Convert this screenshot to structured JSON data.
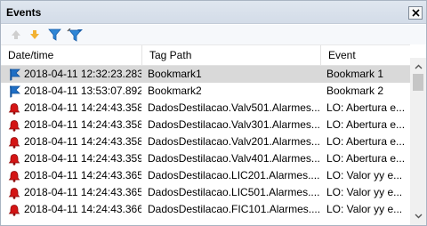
{
  "panel": {
    "title": "Events"
  },
  "toolbar": {
    "buttons": [
      {
        "name": "move-up",
        "color": "#c8c8c8"
      },
      {
        "name": "move-down",
        "color": "#f0b23c"
      },
      {
        "name": "filter",
        "color": "#2a7fd4"
      },
      {
        "name": "filter-edit",
        "color": "#2a7fd4"
      }
    ]
  },
  "table": {
    "columns": [
      "Date/time",
      "Tag Path",
      "Event"
    ],
    "rows": [
      {
        "icon": "bookmark-flag",
        "date": "2018-04-11 12:32:23.283",
        "tag": "Bookmark1",
        "event": "Bookmark 1",
        "selected": true
      },
      {
        "icon": "bookmark-flag",
        "date": "2018-04-11 13:53:07.892",
        "tag": "Bookmark2",
        "event": "Bookmark 2",
        "selected": false
      },
      {
        "icon": "alarm-bell",
        "date": "2018-04-11 14:24:43.358",
        "tag": "DadosDestilacao.Valv501.Alarmes....",
        "event": "LO: Abertura e...",
        "selected": false
      },
      {
        "icon": "alarm-bell",
        "date": "2018-04-11 14:24:43.358",
        "tag": "DadosDestilacao.Valv301.Alarmes....",
        "event": "LO: Abertura e...",
        "selected": false
      },
      {
        "icon": "alarm-bell",
        "date": "2018-04-11 14:24:43.358",
        "tag": "DadosDestilacao.Valv201.Alarmes....",
        "event": "LO: Abertura e...",
        "selected": false
      },
      {
        "icon": "alarm-bell",
        "date": "2018-04-11 14:24:43.359",
        "tag": "DadosDestilacao.Valv401.Alarmes....",
        "event": "LO: Abertura e...",
        "selected": false
      },
      {
        "icon": "alarm-bell",
        "date": "2018-04-11 14:24:43.365",
        "tag": "DadosDestilacao.LIC201.Alarmes....",
        "event": "LO: Valor yy e...",
        "selected": false
      },
      {
        "icon": "alarm-bell",
        "date": "2018-04-11 14:24:43.365",
        "tag": "DadosDestilacao.LIC501.Alarmes....",
        "event": "LO: Valor yy e...",
        "selected": false
      },
      {
        "icon": "alarm-bell",
        "date": "2018-04-11 14:24:43.366",
        "tag": "DadosDestilacao.FIC101.Alarmes....",
        "event": "LO: Valor yy e...",
        "selected": false
      }
    ]
  },
  "colors": {
    "bookmark": "#1f6fc5",
    "alarm": "#d41515",
    "selected_row": "#d9d9d9"
  }
}
